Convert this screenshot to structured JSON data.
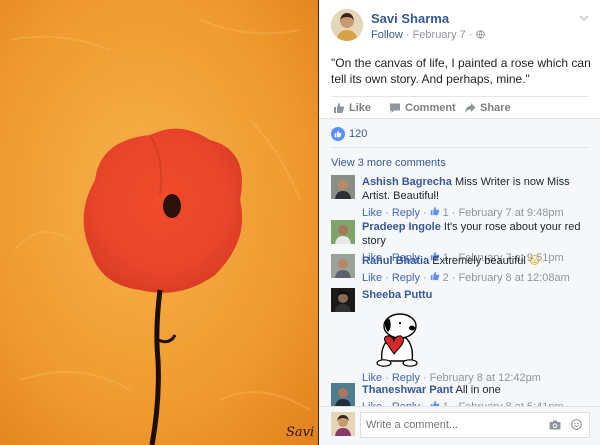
{
  "post": {
    "author": "Savi Sharma",
    "follow": "Follow",
    "dot": " · ",
    "date": "February 7",
    "text": "\"On the canvas of life, I painted a rose which can tell its own story. And perhaps, mine.\"",
    "signature": "Savi"
  },
  "actions": {
    "like": "Like",
    "comment": "Comment",
    "share": "Share"
  },
  "reactions": {
    "count": "120"
  },
  "view_more": "View 3 more comments",
  "comments": [
    {
      "name": "Ashish Bagrecha",
      "text": "Miss Writer is now Miss Artist. Beautiful!",
      "likes": "1",
      "time": "February 7 at 9:48pm"
    },
    {
      "name": "Pradeep Ingole",
      "text": "It's your rose about your red story",
      "likes": "1",
      "time": "February 7 at 9:51pm"
    },
    {
      "name": "Rahul Bhatia",
      "text": "Extremely beautiful",
      "emoji": "☺",
      "likes": "2",
      "time": "February 8 at 12:08am"
    },
    {
      "name": "Sheeba Puttu",
      "text": "",
      "likes": "",
      "time": "February 8 at 12:42pm"
    },
    {
      "name": "Thaneshwar Pant",
      "text": "All in one",
      "likes": "1",
      "time": "February 8 at 5:41pm"
    }
  ],
  "comment_actions": {
    "like": "Like",
    "reply": "Reply",
    "dot": " · "
  },
  "composer": {
    "placeholder": "Write a comment..."
  },
  "icons": [
    "chevron-down-icon",
    "globe-icon",
    "like-icon",
    "comment-icon",
    "share-icon",
    "like-reaction-icon",
    "camera-icon",
    "sticker-icon"
  ],
  "colors": {
    "link": "#365899",
    "muted": "#90949c",
    "like_blue": "#5890ff",
    "poppy_red": "#e8452a",
    "orange_bg": "#f0a030"
  }
}
